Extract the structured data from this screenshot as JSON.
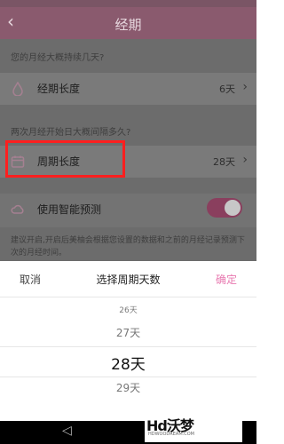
{
  "header": {
    "title": "经期"
  },
  "sections": {
    "period_question": "您的月经大概持续几天?",
    "cycle_question": "两次月经开始日大概间隔多久?"
  },
  "rows": {
    "period_length": {
      "label": "经期长度",
      "value": "6天"
    },
    "cycle_length": {
      "label": "周期长度",
      "value": "28天"
    },
    "smart_predict": {
      "label": "使用智能预测"
    }
  },
  "hint": "建议开启,开启后美柚会根据您设置的数据和之前的月经记录预测下次的月经时间。",
  "picker": {
    "cancel": "取消",
    "title": "选择周期天数",
    "confirm": "确定",
    "options": [
      "26天",
      "27天",
      "28天",
      "29天"
    ],
    "selected": "28天"
  },
  "watermark": {
    "logo": "Hd沃梦",
    "sub": "HDWOODREAM.COM"
  },
  "colors": {
    "accent": "#e879b0",
    "highlight": "#ff1f1f",
    "header": "#8a5a6e"
  },
  "icons": {
    "back": "chevron-left-icon",
    "period": "drop-icon",
    "cycle": "calendar-icon",
    "smart": "cloud-icon"
  }
}
